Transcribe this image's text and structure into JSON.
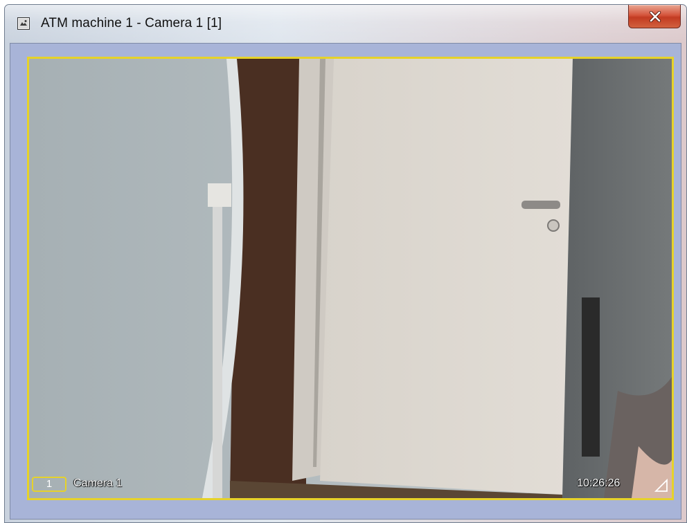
{
  "window": {
    "title": "ATM machine 1 - Camera 1 [1]",
    "icon": "camera-window-icon",
    "close_icon": "close-icon"
  },
  "video": {
    "camera_number": "1",
    "camera_name": "Camera 1",
    "timestamp": "10:26:26",
    "border_color": "#e6d22a",
    "resize_icon": "resize-icon"
  }
}
